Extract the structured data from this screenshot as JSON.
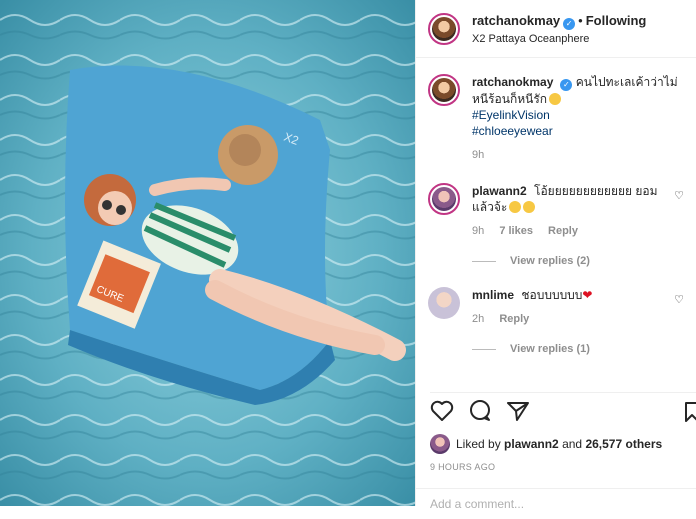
{
  "header": {
    "username": "ratchanokmay",
    "follow_label": "Following",
    "location": "X2 Pattaya Oceanphere"
  },
  "caption": {
    "username": "ratchanokmay",
    "text": "คนไปทะเลเค้าว่าไม่หนีร้อนก็หนีรัก",
    "tags": [
      "#EyelinkVision",
      "#chloeeyewear"
    ],
    "time": "9h"
  },
  "comments": [
    {
      "username": "plawann2",
      "text": "โอ้ยยยยยยยยยยยย ยอมแล้วจ้ะ",
      "time": "9h",
      "likes": "7 likes",
      "reply_label": "Reply",
      "view_replies": "View replies (2)"
    },
    {
      "username": "mnlime",
      "text": "ชอบบบบบบ",
      "time": "2h",
      "reply_label": "Reply",
      "view_replies": "View replies (1)"
    }
  ],
  "likes": {
    "liked_by_prefix": "Liked by",
    "liker": "plawann2",
    "middle": "and",
    "others": "26,577 others"
  },
  "post_time": "9 HOURS AGO",
  "add_comment_placeholder": "Add a comment...",
  "photo": {
    "badge_text": "X2",
    "magazine_title": "CURE"
  },
  "colors": {
    "water": "#5fb4c9",
    "float": "#4fa8d6",
    "link": "#003569",
    "verified": "#3897f0"
  }
}
